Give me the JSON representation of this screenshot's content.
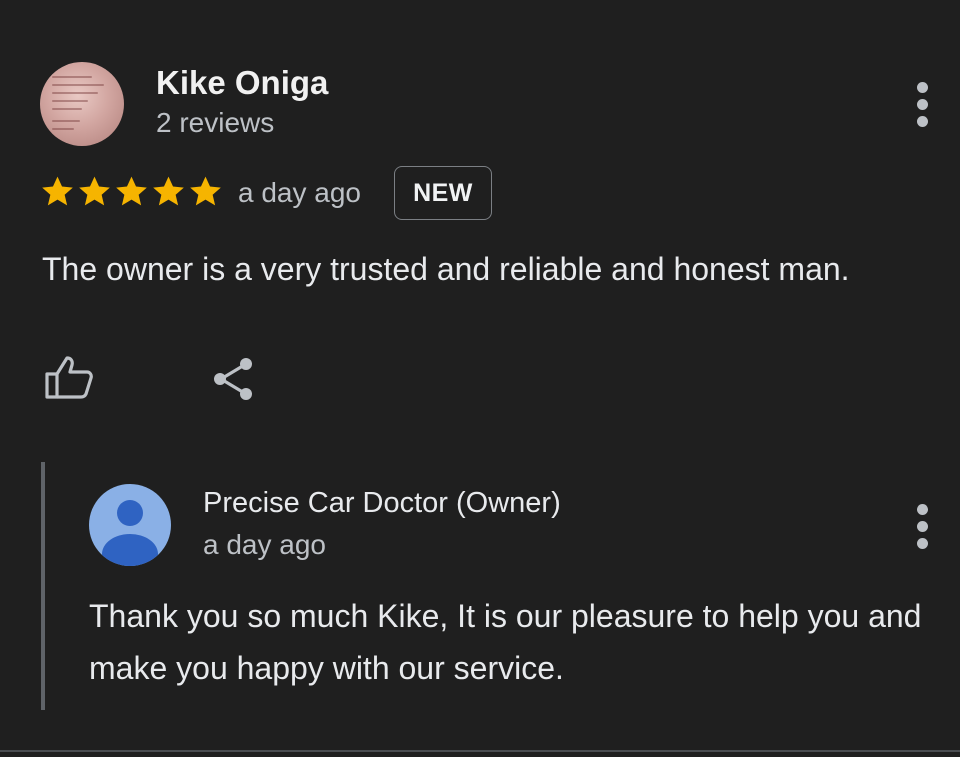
{
  "review": {
    "reviewer_name": "Kike Oniga",
    "reviewer_meta": "2 reviews",
    "rating": 5,
    "rating_max": 5,
    "time_ago": "a day ago",
    "badge": "NEW",
    "text": "The owner is a very trusted and reliable and honest man."
  },
  "reply": {
    "owner_name": "Precise Car Doctor (Owner)",
    "time_ago": "a day ago",
    "text": "Thank you so much Kike, It is our pleasure to help you and make you happy with our service."
  },
  "colors": {
    "background": "#1f1f1f",
    "star": "#f6b400",
    "owner_avatar": "#8ab0e6",
    "owner_avatar_figure": "#2f63c2"
  },
  "icons": {
    "more": "more-vert-icon",
    "like": "thumb-up-icon",
    "share": "share-icon",
    "star": "star-icon"
  }
}
